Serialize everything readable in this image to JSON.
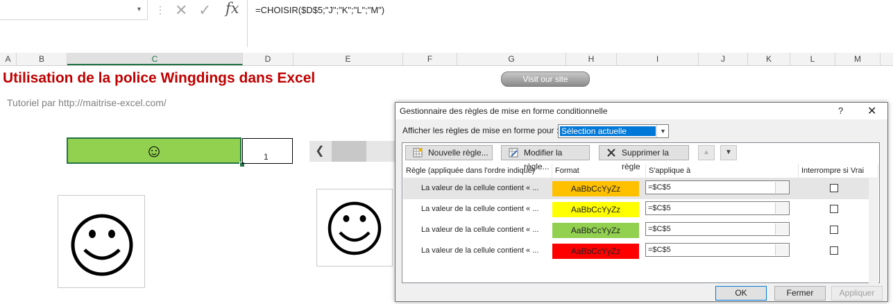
{
  "formula_bar": {
    "formula": "=CHOISIR($D$5;\"J\";\"K\";\"L\";\"M\")",
    "fx_label": "fx"
  },
  "columns": [
    "A",
    "B",
    "C",
    "D",
    "E",
    "F",
    "G",
    "H",
    "I",
    "J",
    "K",
    "L",
    "M"
  ],
  "sheet": {
    "title": "Utilisation de la police Wingdings dans Excel",
    "subtitle": "Tutoriel par http://maitrise-excel.com/",
    "visit_button": "Visit our site",
    "smiley_cell": "☺",
    "value_cell": "1"
  },
  "dialog": {
    "title": "Gestionnaire des règles de mise en forme conditionnelle",
    "help": "?",
    "close": "✕",
    "show_label": "Afficher les règles de mise en forme pour :",
    "show_value": "Sélection actuelle",
    "buttons": {
      "new": "Nouvelle règle...",
      "edit": "Modifier la règle...",
      "delete": "Supprimer la règle"
    },
    "headers": {
      "rule": "Règle (appliquée dans l'ordre indiqué)",
      "format": "Format",
      "applies": "S'applique à",
      "stop": "Interrompre si Vrai"
    },
    "rules": [
      {
        "text": "La valeur de la cellule contient « ...",
        "sample": "AaBbCcYyZz",
        "color": "#ffc000",
        "applies": "=$C$5"
      },
      {
        "text": "La valeur de la cellule contient « ...",
        "sample": "AaBbCcYyZz",
        "color": "#ffff00",
        "applies": "=$C$5"
      },
      {
        "text": "La valeur de la cellule contient « ...",
        "sample": "AaBbCcYyZz",
        "color": "#92d050",
        "applies": "=$C$5"
      },
      {
        "text": "La valeur de la cellule contient « ...",
        "sample": "AaBbCcYyZz",
        "color": "#ff0000",
        "applies": "=$C$5"
      }
    ],
    "ok": "OK",
    "cancel": "Fermer",
    "apply": "Appliquer"
  }
}
